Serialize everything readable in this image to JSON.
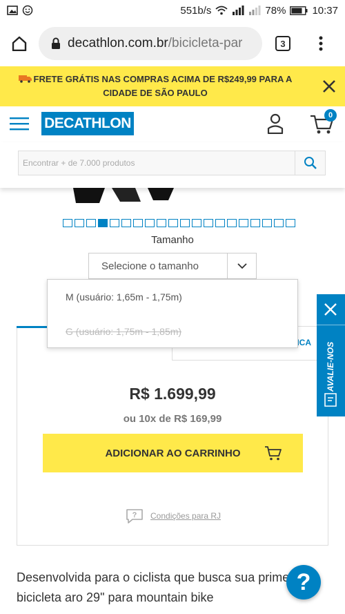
{
  "status_bar": {
    "network_speed": "551b/s",
    "battery": "78%",
    "time": "10:37"
  },
  "browser": {
    "url_domain": "decathlon.com.br",
    "url_path": "/bicicleta-par",
    "tab_count": "3"
  },
  "promo": {
    "text": "FRETE GRÁTIS NAS COMPRAS ACIMA DE R$249,99 PARA A CIDADE DE SÃO PAULO"
  },
  "header": {
    "logo": "DECATHLON",
    "cart_count": "0"
  },
  "search": {
    "placeholder": "Encontrar + de 7.000 produtos"
  },
  "gallery": {
    "total_images": 20,
    "active_index": 4
  },
  "size": {
    "label": "Tamanho",
    "placeholder": "Selecione o tamanho",
    "options": [
      {
        "label": "M (usuário: 1,65m - 1,75m)",
        "available": true
      },
      {
        "label": "G (usuário: 1,75m - 1,85m)",
        "available": false
      }
    ]
  },
  "tabs": {
    "right_partial": "ICA"
  },
  "pricing": {
    "price": "R$ 1.699,99",
    "installment": "ou 10x de R$ 169,99"
  },
  "cart_button": {
    "label": "ADICIONAR AO CARRINHO"
  },
  "conditions": {
    "link": "Condições para RJ"
  },
  "description": {
    "text": "Desenvolvida para o ciclista que busca sua primeira bicicleta aro 29\" para mountain bike"
  },
  "review_tab": {
    "label": "AVALIE-NOS"
  },
  "help": {
    "symbol": "?"
  },
  "colors": {
    "brand_blue": "#0082c3",
    "promo_yellow": "#ffe94a"
  }
}
